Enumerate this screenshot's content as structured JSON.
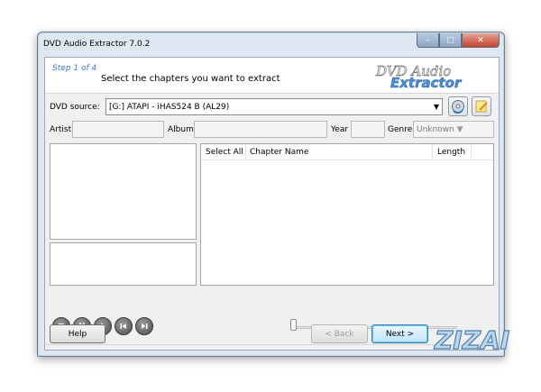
{
  "window": {
    "title": "DVD Audio Extractor 7.0.2",
    "min_glyph": "–",
    "max_glyph": "□",
    "close_glyph": "✕"
  },
  "header": {
    "step": "Step 1 of 4",
    "instruction": "Select the chapters you want to extract",
    "logo_top": "DVD Audio",
    "logo_bottom": "Extractor"
  },
  "source": {
    "label": "DVD source:",
    "value": "[G:]  ATAPI    - iHAS524   B      (AL29)"
  },
  "meta": {
    "artist_label": "Artist",
    "artist_value": "",
    "album_label": "Album",
    "album_value": "",
    "year_label": "Year",
    "year_value": "",
    "genre_label": "Genre",
    "genre_value": "Unknown"
  },
  "chapters": {
    "columns": [
      "Select All",
      "Chapter Name",
      "Length"
    ]
  },
  "media_controls": [
    "stop-icon",
    "pause-icon",
    "play-icon",
    "previous-icon",
    "next-icon"
  ],
  "buttons": {
    "help": "Help",
    "back": "< Back",
    "next": "Next >"
  },
  "watermark": "ZIZAI",
  "colors": {
    "accent": "#3f78c6",
    "logo_blue": "#4a8fd8",
    "default_button": "#bee6fd"
  }
}
